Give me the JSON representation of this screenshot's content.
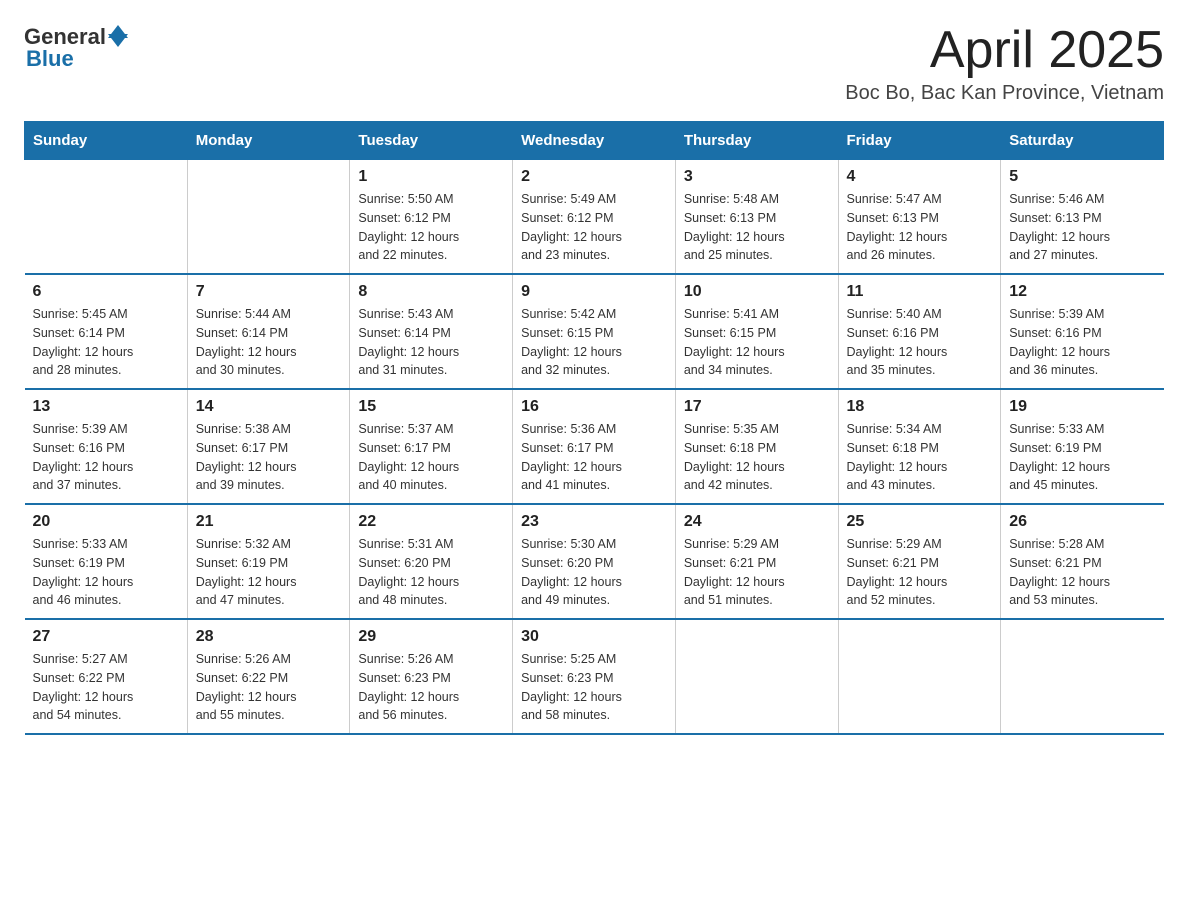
{
  "header": {
    "logo_general": "General",
    "logo_blue": "Blue",
    "month_year": "April 2025",
    "location": "Boc Bo, Bac Kan Province, Vietnam"
  },
  "weekdays": [
    "Sunday",
    "Monday",
    "Tuesday",
    "Wednesday",
    "Thursday",
    "Friday",
    "Saturday"
  ],
  "weeks": [
    [
      {
        "day": "",
        "info": ""
      },
      {
        "day": "",
        "info": ""
      },
      {
        "day": "1",
        "info": "Sunrise: 5:50 AM\nSunset: 6:12 PM\nDaylight: 12 hours\nand 22 minutes."
      },
      {
        "day": "2",
        "info": "Sunrise: 5:49 AM\nSunset: 6:12 PM\nDaylight: 12 hours\nand 23 minutes."
      },
      {
        "day": "3",
        "info": "Sunrise: 5:48 AM\nSunset: 6:13 PM\nDaylight: 12 hours\nand 25 minutes."
      },
      {
        "day": "4",
        "info": "Sunrise: 5:47 AM\nSunset: 6:13 PM\nDaylight: 12 hours\nand 26 minutes."
      },
      {
        "day": "5",
        "info": "Sunrise: 5:46 AM\nSunset: 6:13 PM\nDaylight: 12 hours\nand 27 minutes."
      }
    ],
    [
      {
        "day": "6",
        "info": "Sunrise: 5:45 AM\nSunset: 6:14 PM\nDaylight: 12 hours\nand 28 minutes."
      },
      {
        "day": "7",
        "info": "Sunrise: 5:44 AM\nSunset: 6:14 PM\nDaylight: 12 hours\nand 30 minutes."
      },
      {
        "day": "8",
        "info": "Sunrise: 5:43 AM\nSunset: 6:14 PM\nDaylight: 12 hours\nand 31 minutes."
      },
      {
        "day": "9",
        "info": "Sunrise: 5:42 AM\nSunset: 6:15 PM\nDaylight: 12 hours\nand 32 minutes."
      },
      {
        "day": "10",
        "info": "Sunrise: 5:41 AM\nSunset: 6:15 PM\nDaylight: 12 hours\nand 34 minutes."
      },
      {
        "day": "11",
        "info": "Sunrise: 5:40 AM\nSunset: 6:16 PM\nDaylight: 12 hours\nand 35 minutes."
      },
      {
        "day": "12",
        "info": "Sunrise: 5:39 AM\nSunset: 6:16 PM\nDaylight: 12 hours\nand 36 minutes."
      }
    ],
    [
      {
        "day": "13",
        "info": "Sunrise: 5:39 AM\nSunset: 6:16 PM\nDaylight: 12 hours\nand 37 minutes."
      },
      {
        "day": "14",
        "info": "Sunrise: 5:38 AM\nSunset: 6:17 PM\nDaylight: 12 hours\nand 39 minutes."
      },
      {
        "day": "15",
        "info": "Sunrise: 5:37 AM\nSunset: 6:17 PM\nDaylight: 12 hours\nand 40 minutes."
      },
      {
        "day": "16",
        "info": "Sunrise: 5:36 AM\nSunset: 6:17 PM\nDaylight: 12 hours\nand 41 minutes."
      },
      {
        "day": "17",
        "info": "Sunrise: 5:35 AM\nSunset: 6:18 PM\nDaylight: 12 hours\nand 42 minutes."
      },
      {
        "day": "18",
        "info": "Sunrise: 5:34 AM\nSunset: 6:18 PM\nDaylight: 12 hours\nand 43 minutes."
      },
      {
        "day": "19",
        "info": "Sunrise: 5:33 AM\nSunset: 6:19 PM\nDaylight: 12 hours\nand 45 minutes."
      }
    ],
    [
      {
        "day": "20",
        "info": "Sunrise: 5:33 AM\nSunset: 6:19 PM\nDaylight: 12 hours\nand 46 minutes."
      },
      {
        "day": "21",
        "info": "Sunrise: 5:32 AM\nSunset: 6:19 PM\nDaylight: 12 hours\nand 47 minutes."
      },
      {
        "day": "22",
        "info": "Sunrise: 5:31 AM\nSunset: 6:20 PM\nDaylight: 12 hours\nand 48 minutes."
      },
      {
        "day": "23",
        "info": "Sunrise: 5:30 AM\nSunset: 6:20 PM\nDaylight: 12 hours\nand 49 minutes."
      },
      {
        "day": "24",
        "info": "Sunrise: 5:29 AM\nSunset: 6:21 PM\nDaylight: 12 hours\nand 51 minutes."
      },
      {
        "day": "25",
        "info": "Sunrise: 5:29 AM\nSunset: 6:21 PM\nDaylight: 12 hours\nand 52 minutes."
      },
      {
        "day": "26",
        "info": "Sunrise: 5:28 AM\nSunset: 6:21 PM\nDaylight: 12 hours\nand 53 minutes."
      }
    ],
    [
      {
        "day": "27",
        "info": "Sunrise: 5:27 AM\nSunset: 6:22 PM\nDaylight: 12 hours\nand 54 minutes."
      },
      {
        "day": "28",
        "info": "Sunrise: 5:26 AM\nSunset: 6:22 PM\nDaylight: 12 hours\nand 55 minutes."
      },
      {
        "day": "29",
        "info": "Sunrise: 5:26 AM\nSunset: 6:23 PM\nDaylight: 12 hours\nand 56 minutes."
      },
      {
        "day": "30",
        "info": "Sunrise: 5:25 AM\nSunset: 6:23 PM\nDaylight: 12 hours\nand 58 minutes."
      },
      {
        "day": "",
        "info": ""
      },
      {
        "day": "",
        "info": ""
      },
      {
        "day": "",
        "info": ""
      }
    ]
  ]
}
